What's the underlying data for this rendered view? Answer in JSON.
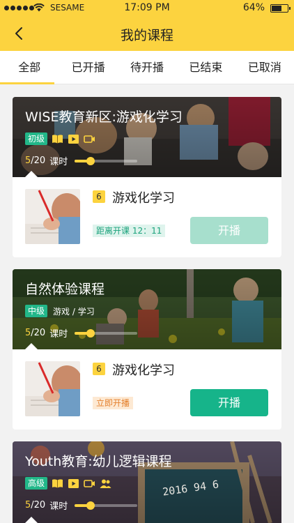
{
  "status_bar": {
    "carrier": "SESAME",
    "time": "17:09 PM",
    "battery": "64%"
  },
  "nav": {
    "title": "我的课程"
  },
  "tabs": [
    {
      "label": "全部",
      "active": true
    },
    {
      "label": "已开播",
      "active": false
    },
    {
      "label": "待开播",
      "active": false
    },
    {
      "label": "已结束",
      "active": false
    },
    {
      "label": "已取消",
      "active": false
    }
  ],
  "courses": [
    {
      "title": "WISE教育新区:游戏化学习",
      "level": "初级",
      "subtitle": "",
      "icons": [
        "book-icon",
        "video-play-icon",
        "camera-icon"
      ],
      "progress_current": "5",
      "progress_total": "/20",
      "progress_unit": "课时",
      "progress_fraction": 0.25,
      "lesson": {
        "number": "6",
        "title": "游戏化学习",
        "info": "距离开课 12：11",
        "button": "开播",
        "button_state": "disabled"
      }
    },
    {
      "title": "自然体验课程",
      "level": "中级",
      "subtitle": "游戏 / 学习",
      "icons": [],
      "progress_current": "5",
      "progress_total": "/20",
      "progress_unit": "课时",
      "progress_fraction": 0.25,
      "lesson": {
        "number": "6",
        "title": "游戏化学习",
        "info": "立即开播",
        "button": "开播",
        "button_state": "primary"
      }
    },
    {
      "title": "Youth教育:幼儿逻辑课程",
      "level": "高级",
      "subtitle": "",
      "icons": [
        "book-icon",
        "video-play-icon",
        "camera-icon",
        "group-icon"
      ],
      "progress_current": "5",
      "progress_total": "/20",
      "progress_unit": "课时",
      "progress_fraction": 0.25,
      "board_text": "2016 94 6"
    }
  ],
  "colors": {
    "brand_yellow": "#fcd33f",
    "level_green": "#22b789",
    "button_green": "#16b48a",
    "button_disabled": "#a7dfcd"
  }
}
